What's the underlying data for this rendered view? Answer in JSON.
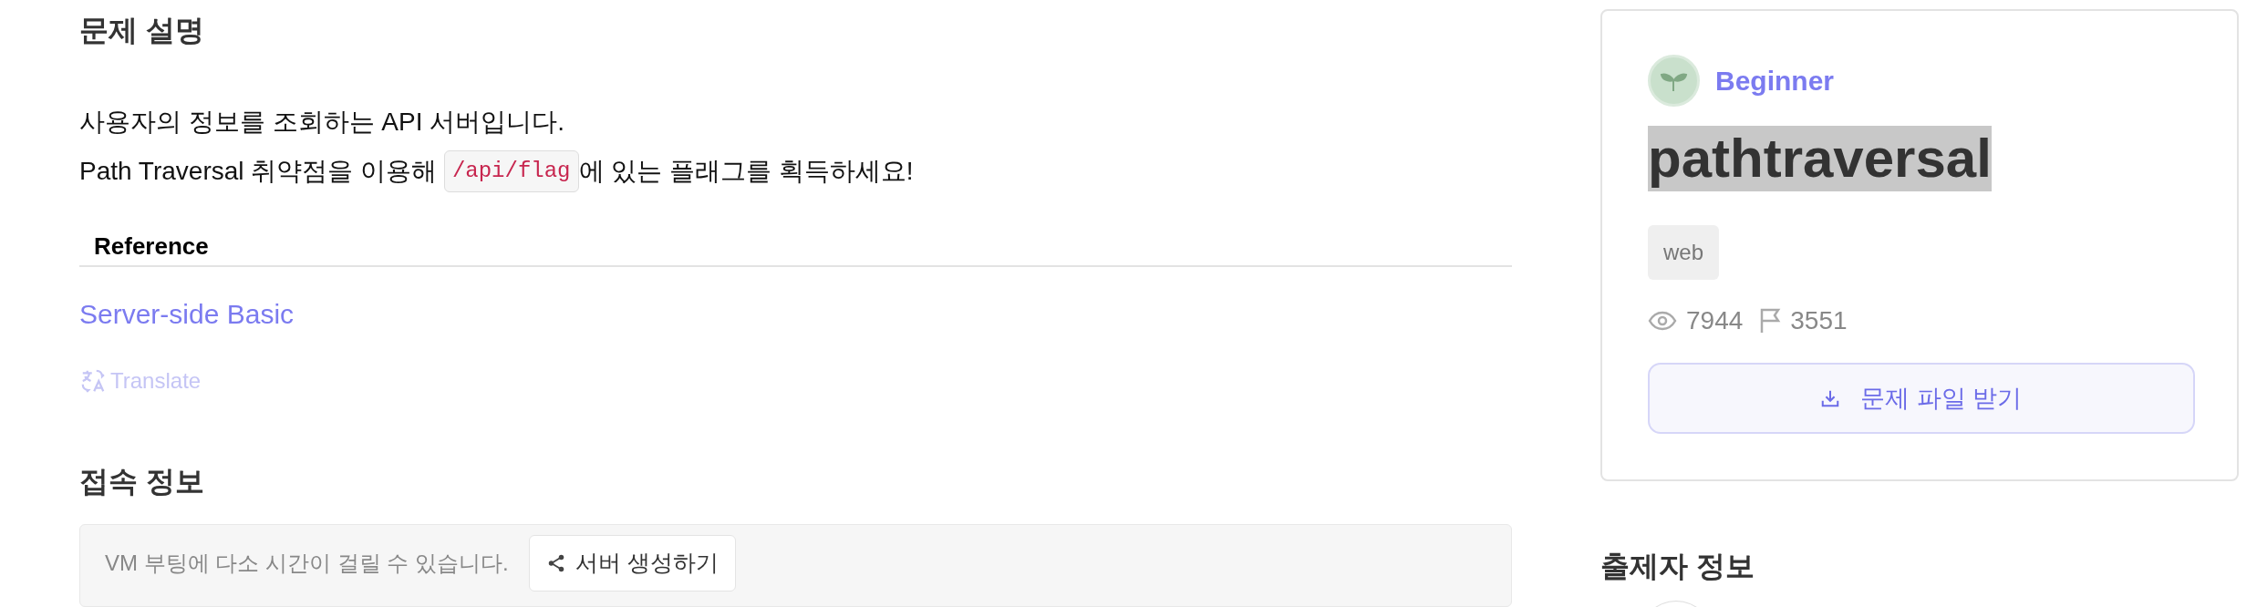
{
  "description": {
    "heading": "문제 설명",
    "lines": [
      [
        {
          "kind": "text",
          "text": "사용자의 정보를 조회하는 API 서버입니다."
        }
      ],
      [
        {
          "kind": "text",
          "text": "Path Traversal 취약점을 이용해 "
        },
        {
          "kind": "code",
          "text": "/api/flag"
        },
        {
          "kind": "text",
          "text": "에 있는 플래그를 획득하세요!"
        }
      ]
    ]
  },
  "reference": {
    "heading": "Reference",
    "links": [
      "Server-side Basic"
    ]
  },
  "translate": "Translate",
  "connection": {
    "heading": "접속 정보",
    "notice": "VM 부팅에 다소 시간이 걸릴 수 있습니다.",
    "button": "서버 생성하기"
  },
  "challenge": {
    "level": "Beginner",
    "title": "pathtraversal",
    "title_highlighted": true,
    "tags": [
      "web"
    ],
    "stats": [
      {
        "kind": "views",
        "value": "7944"
      },
      {
        "kind": "solves",
        "value": "3551"
      }
    ],
    "download_button": "문제 파일 받기"
  },
  "author": {
    "heading": "출제자 정보"
  }
}
